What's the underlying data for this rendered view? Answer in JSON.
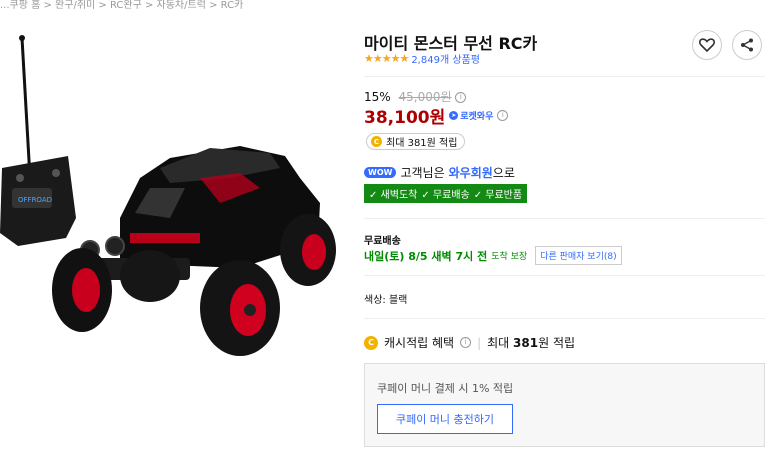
{
  "breadcrumb": {
    "text": "...쿠팡 홈 > 완구/취미 > RC완구 > 자동차/트럭 > RC카"
  },
  "product": {
    "title": "마이티 몬스터 무선 RC카",
    "stars": "★★★★★",
    "review_count": "2,849개 상품평"
  },
  "icons": [
    "heart-icon",
    "share-icon",
    "info-icon",
    "rocket-icon",
    "coin-icon",
    "check-icon"
  ],
  "price": {
    "discount": "15%",
    "original": "45,000원",
    "info_glyph": "i",
    "sale": "38,100원",
    "rocket_label": "로켓와우"
  },
  "reward": {
    "coin_glyph": "C",
    "text": "최대 381원 적립"
  },
  "wow": {
    "badge": "WOW",
    "prefix": "고객님은",
    "member": "와우회원",
    "suffix": "으로"
  },
  "benefits": [
    "✓ 새벽도착",
    "✓ 무료배송",
    "✓ 무료반품"
  ],
  "shipping": {
    "label": "무료배송",
    "date": "내일(토) 8/5 새벽 7시 전",
    "note": "도착 보장",
    "other_seller": "다른 판매자 보기(8)"
  },
  "option": {
    "color": "색상: 블랙"
  },
  "cash": {
    "label": "캐시적립 혜택",
    "pipe": "|",
    "prefix": "최대",
    "amount": "381",
    "suffix": "원 적립"
  },
  "coupay": {
    "text": "쿠페이 머니 결제 시 1% 적립",
    "button": "쿠페이 머니 충전하기"
  },
  "colors": {
    "accent": "#346aff",
    "price": "#ae0000",
    "ship_green": "#008c00",
    "benefit_bg": "#138a13",
    "star": "#f5a623"
  }
}
